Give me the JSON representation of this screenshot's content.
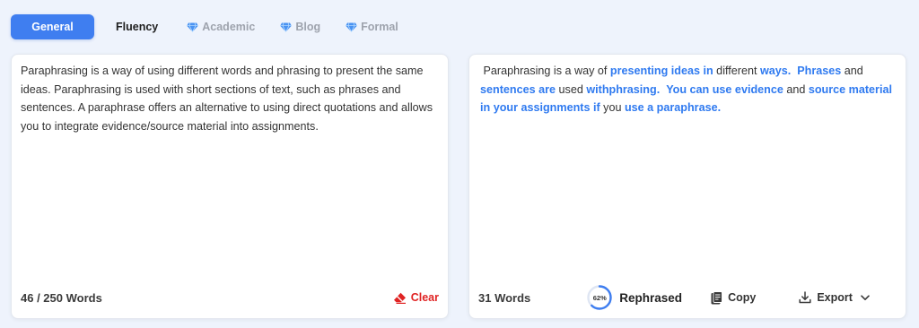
{
  "tabs": [
    {
      "label": "General",
      "active": true,
      "premium": false
    },
    {
      "label": "Fluency",
      "active": false,
      "premium": false
    },
    {
      "label": "Academic",
      "active": false,
      "premium": true
    },
    {
      "label": "Blog",
      "active": false,
      "premium": true
    },
    {
      "label": "Formal",
      "active": false,
      "premium": true
    }
  ],
  "colors": {
    "accent": "#3f7ef0",
    "highlight": "#2f7af0",
    "clear": "#e02424",
    "background": "#eef3fc"
  },
  "input": {
    "text": "Paraphrasing is a way of using different words and phrasing to present the same ideas. Paraphrasing is used with short sections of text, such as phrases and sentences. A paraphrase offers an alternative to using direct quotations and allows you to integrate evidence/source material into assignments.",
    "word_count": "46 / 250 Words",
    "clear_label": "Clear",
    "clear_icon": "eraser-icon"
  },
  "output": {
    "segments": [
      {
        "text": " Paraphrasing is a way of ",
        "changed": false
      },
      {
        "text": "presenting ideas in",
        "changed": true
      },
      {
        "text": " different ",
        "changed": false
      },
      {
        "text": "ways.",
        "changed": true
      },
      {
        "text": "  ",
        "changed": false
      },
      {
        "text": "Phrases",
        "changed": true
      },
      {
        "text": " and ",
        "changed": false
      },
      {
        "text": "sentences are",
        "changed": true
      },
      {
        "text": " used ",
        "changed": false
      },
      {
        "text": "withphrasing.",
        "changed": true
      },
      {
        "text": "  ",
        "changed": false
      },
      {
        "text": "You can use evidence",
        "changed": true
      },
      {
        "text": " and ",
        "changed": false
      },
      {
        "text": "source material in your assignments if",
        "changed": true
      },
      {
        "text": " you ",
        "changed": false
      },
      {
        "text": "use a paraphrase.",
        "changed": true
      }
    ],
    "word_count": "31 Words",
    "rephrased_percent": 62,
    "rephrased_percent_label": "62%",
    "rephrased_label": "Rephrased",
    "copy_label": "Copy",
    "copy_icon": "clipboard-icon",
    "export_label": "Export",
    "export_icon": "download-icon"
  }
}
